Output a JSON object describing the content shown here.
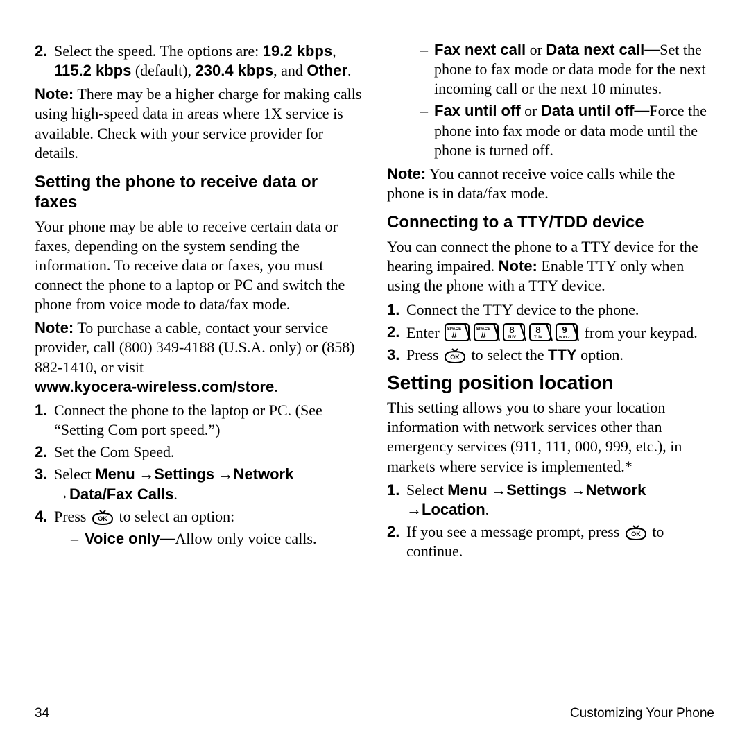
{
  "left": {
    "speed_item_num": "2.",
    "speed_pre": "Select the speed. The options are: ",
    "opt1": "19.2 kbps",
    "opt_sep1": ", ",
    "opt2": "115.2 kbps",
    "opt_default": " (default), ",
    "opt3": "230.4 kbps",
    "opt_and": ", and ",
    "opt4": "Other",
    "opt_end": ".",
    "note_label": "Note:",
    "note1_text": "  There may be a higher charge for making calls using high-speed data in areas where 1X service is available. Check with your service provider for details.",
    "h3_data_fax": "Setting the phone to receive data or faxes",
    "datafax_intro": "Your phone may be able to receive certain data or faxes, depending on the system sending the information. To receive data or faxes, you must connect the phone to a laptop or PC and switch the phone from voice mode to data/fax mode.",
    "note2_text": "  To purchase a cable, contact your service provider, call (800) 349-4188 (U.S.A. only) or (858) 882-1410, or visit ",
    "store_url": "www.kyocera-wireless.com/store",
    "df1_num": "1.",
    "df1": "Connect the phone to the laptop or PC. (See “Setting Com port speed.”)",
    "df2_num": "2.",
    "df2": "Set the Com Speed.",
    "df3_num": "3.",
    "df3_pre": "Select ",
    "menu": "Menu",
    "settings": "Settings",
    "network": "Network",
    "dfcalls": "Data/Fax Calls",
    "df4_num": "4.",
    "df4_pre": "Press ",
    "df4_post": " to select an option:",
    "voice_only_label": "Voice only—",
    "voice_only_text": "Allow only voice calls."
  },
  "right": {
    "fax_next_label": "Fax next call",
    "or": " or ",
    "data_next_label": "Data next call—",
    "fax_next_text": "Set the phone to fax mode or data mode for the next incoming call or the next 10 minutes.",
    "fax_until_label": "Fax until off",
    "data_until_label": "Data until off—",
    "fax_until_text": "Force the phone into fax mode or data mode until the phone is turned off.",
    "note_label": "Note:",
    "note3_text": "  You cannot receive voice calls while the phone is in data/fax mode.",
    "h3_tty": "Connecting to a TTY/TDD device",
    "tty_intro_pre": "You can connect the phone to a TTY device for the hearing impaired. ",
    "tty_note_label": "Note:",
    "tty_intro_post": " Enable TTY only when using the phone with a TTY device.",
    "tty1_num": "1.",
    "tty1": "Connect the TTY device to the phone.",
    "tty2_num": "2.",
    "tty2_pre": "Enter ",
    "tty2_post": " from your keypad.",
    "tty3_num": "3.",
    "tty3_pre": "Press ",
    "tty3_mid": " to select the ",
    "tty_opt": "TTY",
    "tty3_post": " option.",
    "h2_location": "Setting position location",
    "loc_text": "This setting allows you to share your location information with network services other than emergency services (911, 111, 000, 999, etc.), in markets where service is implemented.*",
    "loc1_num": "1.",
    "loc1_pre": "Select ",
    "menu": "Menu",
    "settings": "Settings",
    "network": "Network",
    "location": "Location",
    "loc2_num": "2.",
    "loc2_pre": "If you see a message prompt, press ",
    "loc2_post": " to continue."
  },
  "footer": {
    "page_num": "34",
    "chapter": "Customizing Your Phone"
  },
  "icons": {
    "key_hash_top": "SPACE",
    "key_hash_main": "#",
    "key_8_top": "8",
    "key_8_sub": "TUV",
    "key_9_top": "9",
    "key_9_sub": "WXYZ",
    "ok_label": "OK"
  }
}
